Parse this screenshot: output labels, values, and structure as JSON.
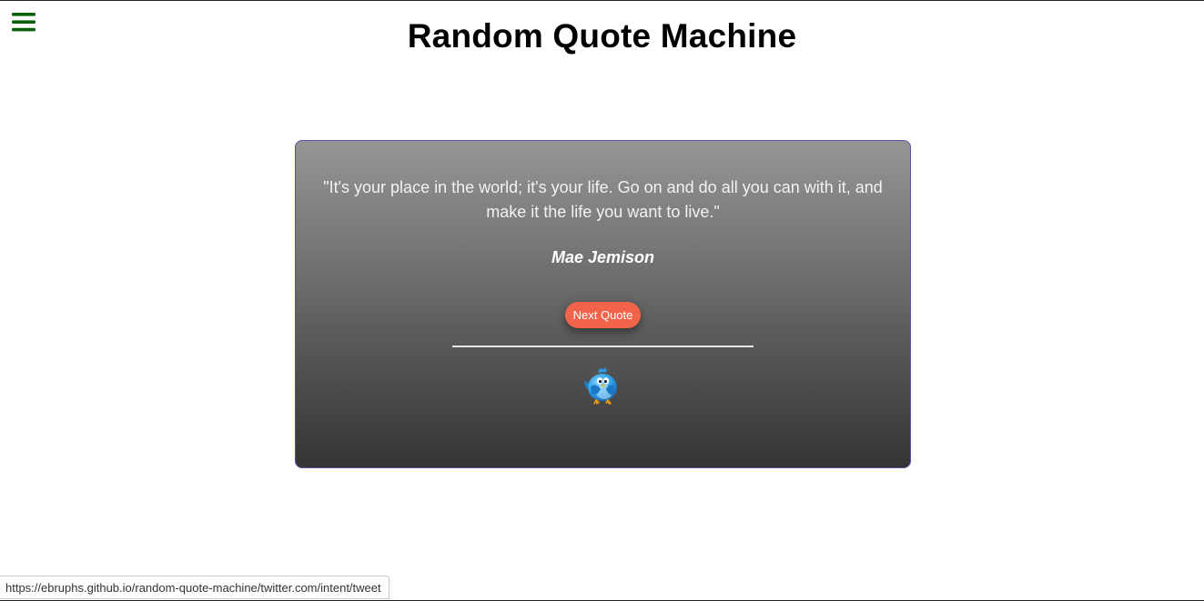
{
  "header": {
    "menu_icon": "hamburger-menu-icon",
    "title": "Random Quote Machine"
  },
  "quote": {
    "text": "\"It's your place in the world; it's your life. Go on and do all you can with it, and make it the life you want to live.\"",
    "author": "Mae Jemison"
  },
  "actions": {
    "next_label": "Next Quote",
    "tweet_icon": "twitter-bird-icon"
  },
  "status_bar": {
    "url": "https://ebruphs.github.io/random-quote-machine/twitter.com/intent/tweet"
  },
  "colors": {
    "menu_icon": "#0b5e0b",
    "next_button": "#f2644a",
    "quote_box_border": "#5b4fa8",
    "gradient_top": "#959595",
    "gradient_bottom": "#343434"
  }
}
